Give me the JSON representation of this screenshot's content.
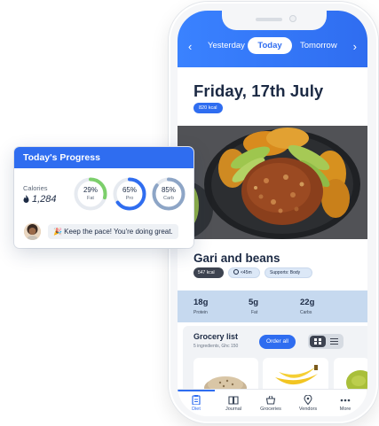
{
  "day_nav": {
    "prev_icon": "chevron-left-icon",
    "next_icon": "chevron-right-icon",
    "yesterday": "Yesterday",
    "today": "Today",
    "tomorrow": "Tomorrow"
  },
  "day": {
    "title": "Friday, 17th July",
    "kcal": "820 kcal"
  },
  "meal": {
    "name": "Gari and beans",
    "kcal": "547 kcal",
    "time": "<45m",
    "supports": "Supports: Body"
  },
  "macros": [
    {
      "value": "18g",
      "label": "Protein"
    },
    {
      "value": "5g",
      "label": "Fat"
    },
    {
      "value": "22g",
      "label": "Carbs"
    }
  ],
  "grocery": {
    "title": "Grocery list",
    "subtitle": "5 ingredients, Ghc 150",
    "order_label": "Order all",
    "view_modes": [
      "grid-icon",
      "list-icon"
    ]
  },
  "tabs": [
    {
      "label": "Diet",
      "icon": "clipboard-icon",
      "active": true
    },
    {
      "label": "Journal",
      "icon": "book-icon",
      "active": false
    },
    {
      "label": "Groceries",
      "icon": "basket-icon",
      "active": false
    },
    {
      "label": "Vendors",
      "icon": "location-pin-icon",
      "active": false
    },
    {
      "label": "More",
      "icon": "more-icon",
      "active": false
    }
  ],
  "progress_card": {
    "title": "Today's Progress",
    "calories_label": "Calories",
    "calories_value": "1,284",
    "rings": [
      {
        "pct": "29%",
        "name": "Fat",
        "fraction": 0.29,
        "color": "#7ccf6b"
      },
      {
        "pct": "65%",
        "name": "Pro",
        "fraction": 0.65,
        "color": "#2f6df0"
      },
      {
        "pct": "85%",
        "name": "Carb",
        "fraction": 0.85,
        "color": "#8da5c6"
      }
    ],
    "message": "🎉 Keep the pace! You're doing great."
  },
  "colors": {
    "accent": "#2f6df0",
    "dark_text": "#1c2a44",
    "macro_band": "#c6d9ef"
  }
}
